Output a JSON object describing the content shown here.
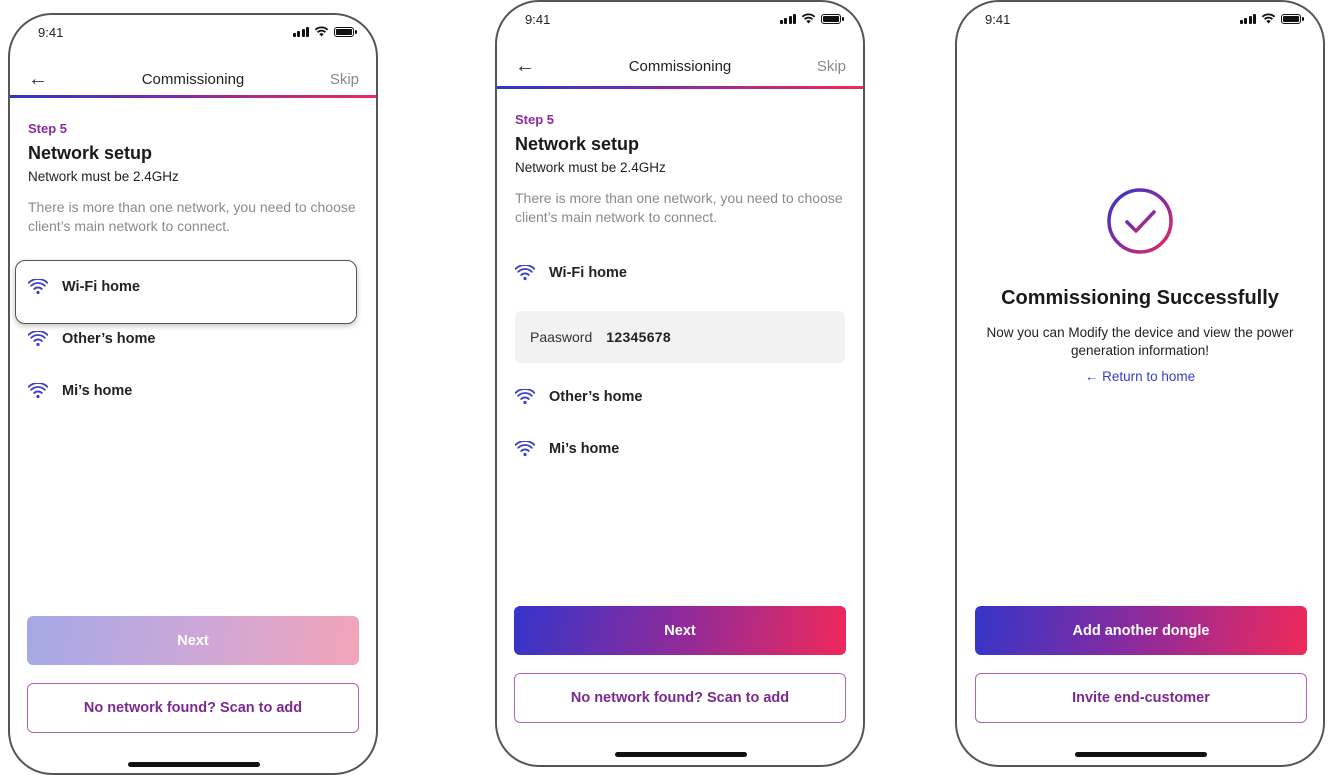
{
  "colors": {
    "accent_purple": "#8b2c9d",
    "gradient_start": "#2b37c8",
    "gradient_end": "#ee2a56",
    "link_blue": "#3540c9"
  },
  "status_bar": {
    "time": "9:41"
  },
  "nav": {
    "back_icon": "arrow-left-icon",
    "title": "Commissioning",
    "skip": "Skip"
  },
  "step": {
    "label": "Step 5",
    "title": "Network setup",
    "requirement": "Network must be 2.4GHz",
    "description": "There is more than one network, you need to choose client’s main network to connect."
  },
  "networks": [
    "Wi-Fi home",
    "Other’s home",
    "Mi’s home"
  ],
  "password": {
    "label": "Paasword",
    "value": "12345678"
  },
  "buttons": {
    "next": "Next",
    "scan": "No network found? Scan to add"
  },
  "success": {
    "title": "Commissioning Successfully",
    "description": "Now you can Modify the device and view the power generation information!",
    "return_link": "← Return to home",
    "add_dongle": "Add another dongle",
    "invite": "Invite end-customer"
  }
}
